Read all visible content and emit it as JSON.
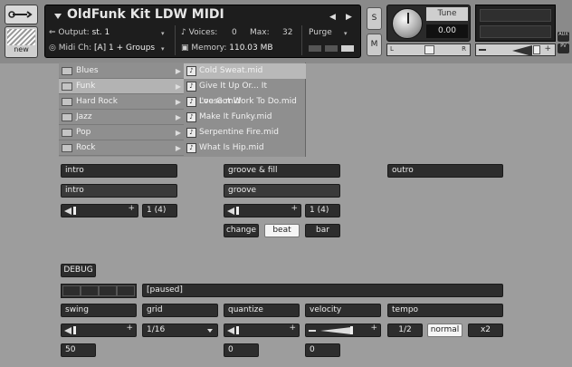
{
  "header": {
    "instrument_name": "OldFunk Kit LDW MIDI",
    "output_label": "Output:",
    "output_value": "st. 1",
    "voices_label": "Voices:",
    "voices_value": "0",
    "max_label": "Max:",
    "max_value": "32",
    "purge_label": "Purge",
    "midi_label": "Midi Ch:",
    "midi_value": "[A]  1 + Groups",
    "memory_label": "Memory:",
    "memory_value": "110.03 MB",
    "new_label": "new",
    "solo_label": "S",
    "mute_label": "M",
    "tune_label": "Tune",
    "tune_value": "0.00",
    "pan_left": "L",
    "pan_right": "R",
    "aux_label": "AUX",
    "pv_label": "PV"
  },
  "browser": {
    "categories": [
      "Blues",
      "Funk",
      "Hard Rock",
      "Jazz",
      "Pop",
      "Rock"
    ],
    "files": [
      "Cold Sweat.mid",
      "Give It Up Or... It Loose.mid",
      "I've Got Work To Do.mid",
      "Make It Funky.mid",
      "Serpentine Fire.mid",
      "What Is Hip.mid"
    ]
  },
  "sections": {
    "intro": {
      "title": "intro",
      "name": "intro",
      "value": "1 (4)"
    },
    "groove": {
      "title": "groove & fill",
      "name": "groove",
      "value": "1 (4)"
    },
    "outro": {
      "title": "outro"
    }
  },
  "change_row": {
    "change": "change",
    "beat": "beat",
    "bar": "bar"
  },
  "debug_label": "DEBUG",
  "status_text": "[paused]",
  "params": {
    "swing": {
      "label": "swing",
      "value": "50"
    },
    "grid": {
      "label": "grid",
      "value": "1/16"
    },
    "quantize": {
      "label": "quantize",
      "value": "0"
    },
    "velocity": {
      "label": "velocity",
      "value": "0"
    },
    "tempo": {
      "label": "tempo",
      "half": "1/2",
      "normal": "normal",
      "double": "x2"
    }
  },
  "colors": {
    "background": "#9d9d9d",
    "panel": "#2d2d2d",
    "accent_on": "#f5f5f5"
  }
}
